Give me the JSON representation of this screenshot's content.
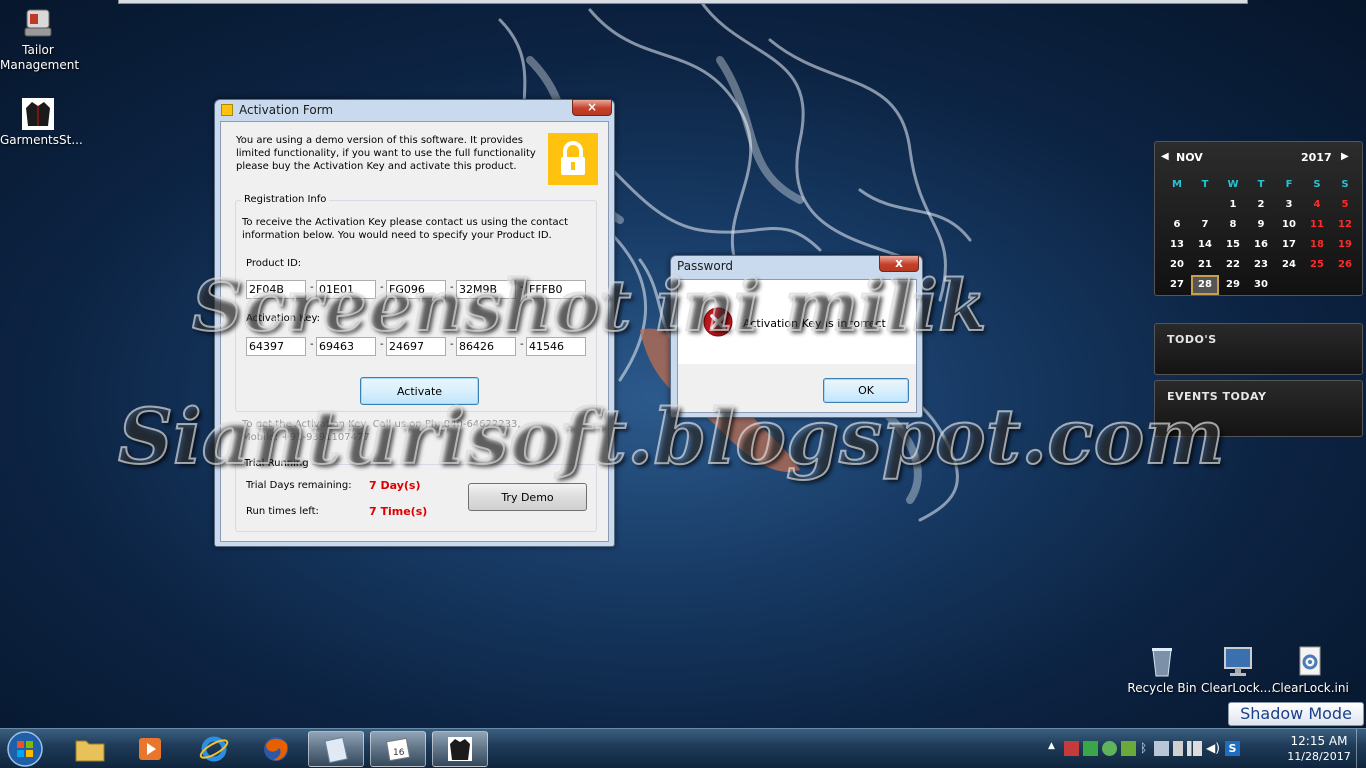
{
  "desktop": {
    "icons_left": [
      {
        "label": "Tailor Management"
      },
      {
        "label": "GarmentsSt..."
      }
    ],
    "icons_right": [
      {
        "label": "Recycle Bin"
      },
      {
        "label": "ClearLock...."
      },
      {
        "label": "ClearLock.ini"
      }
    ]
  },
  "activation_form": {
    "title": "Activation Form",
    "close": "×",
    "intro": "You are using a demo version of this software. It provides limited functionality, if you want to use the full functionality please buy the Activation Key and activate this product.",
    "registration_group": "Registration Info",
    "registration_text": "To receive the Activation Key please contact us using the contact information below. You would need to specify your Product ID.",
    "product_id_label": "Product ID:",
    "product_id": [
      "2F04B",
      "01E01",
      "FG096",
      "32M9B",
      "FFFB0"
    ],
    "activation_key_label": "Activation Key:",
    "activation_key": [
      "64397",
      "69463",
      "24697",
      "86426",
      "41546"
    ],
    "activate_button": "Activate",
    "contact_text": "To get the Activation Key, Call us on Ph: 040-64622233, Mobile: +91-9391107477",
    "trial_group": "Trial Running",
    "trial_days_label": "Trial Days remaining:",
    "trial_days_value": "7 Day(s)",
    "run_times_label": "Run times left:",
    "run_times_value": "7 Time(s)",
    "try_demo_button": "Try Demo"
  },
  "password_dialog": {
    "title": "Password",
    "close": "x",
    "message": "Activation Key is incorrect",
    "ok_button": "OK"
  },
  "calendar": {
    "month": "NOV",
    "year": "2017",
    "weekdays": [
      "M",
      "T",
      "W",
      "T",
      "F",
      "S",
      "S"
    ],
    "days": [
      [
        "",
        "",
        "1",
        "2",
        "3",
        "4",
        "5"
      ],
      [
        "6",
        "7",
        "8",
        "9",
        "10",
        "11",
        "12"
      ],
      [
        "13",
        "14",
        "15",
        "16",
        "17",
        "18",
        "19"
      ],
      [
        "20",
        "21",
        "22",
        "23",
        "24",
        "25",
        "26"
      ],
      [
        "27",
        "28",
        "29",
        "30",
        "",
        "",
        ""
      ]
    ],
    "today": "28"
  },
  "gadgets": {
    "todos": "TODO'S",
    "events": "EVENTS TODAY"
  },
  "shadow_mode": "Shadow Mode",
  "taskbar": {
    "time": "12:15 AM",
    "date": "11/28/2017"
  },
  "watermark": {
    "line1": "Screenshot ini milik",
    "line2": "Sianturisoft.blogspot.com"
  },
  "colors": {
    "accent_yellow": "#ffc20e",
    "error_red": "#dd0000",
    "calendar_weekday": "#26c3d3"
  }
}
